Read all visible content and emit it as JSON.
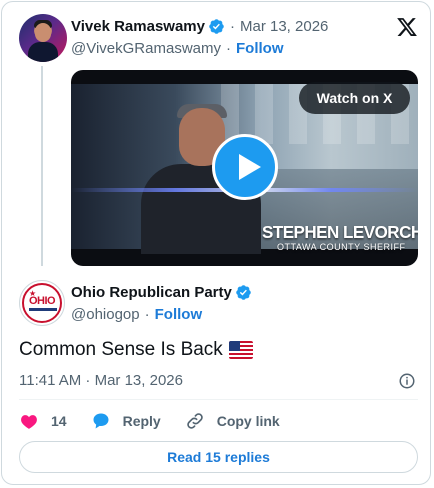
{
  "tweet_top": {
    "name": "Vivek Ramaswamy",
    "separator": "·",
    "date": "Mar 13, 2026",
    "handle": "@VivekGRamaswamy",
    "follow_sep": "·",
    "follow_label": "Follow"
  },
  "video": {
    "watch_label": "Watch on X",
    "lower_third_name": "STEPHEN LEVORCHICK",
    "lower_third_title": "OTTAWA COUNTY SHERIFF"
  },
  "tweet_main": {
    "name": "Ohio Republican Party",
    "handle": "@ohiogop",
    "follow_sep": "·",
    "follow_label": "Follow",
    "body": "Common Sense Is Back",
    "timestamp": "11:41 AM · Mar 13, 2026"
  },
  "avatar2_text": "OHIO",
  "actions": {
    "like_count": "14",
    "reply_label": "Reply",
    "copy_label": "Copy link"
  },
  "read_replies_label": "Read 15 replies",
  "colors": {
    "accent": "#1d9bf0",
    "link": "#1d7bd7",
    "like": "#f91880",
    "muted": "#536471"
  }
}
